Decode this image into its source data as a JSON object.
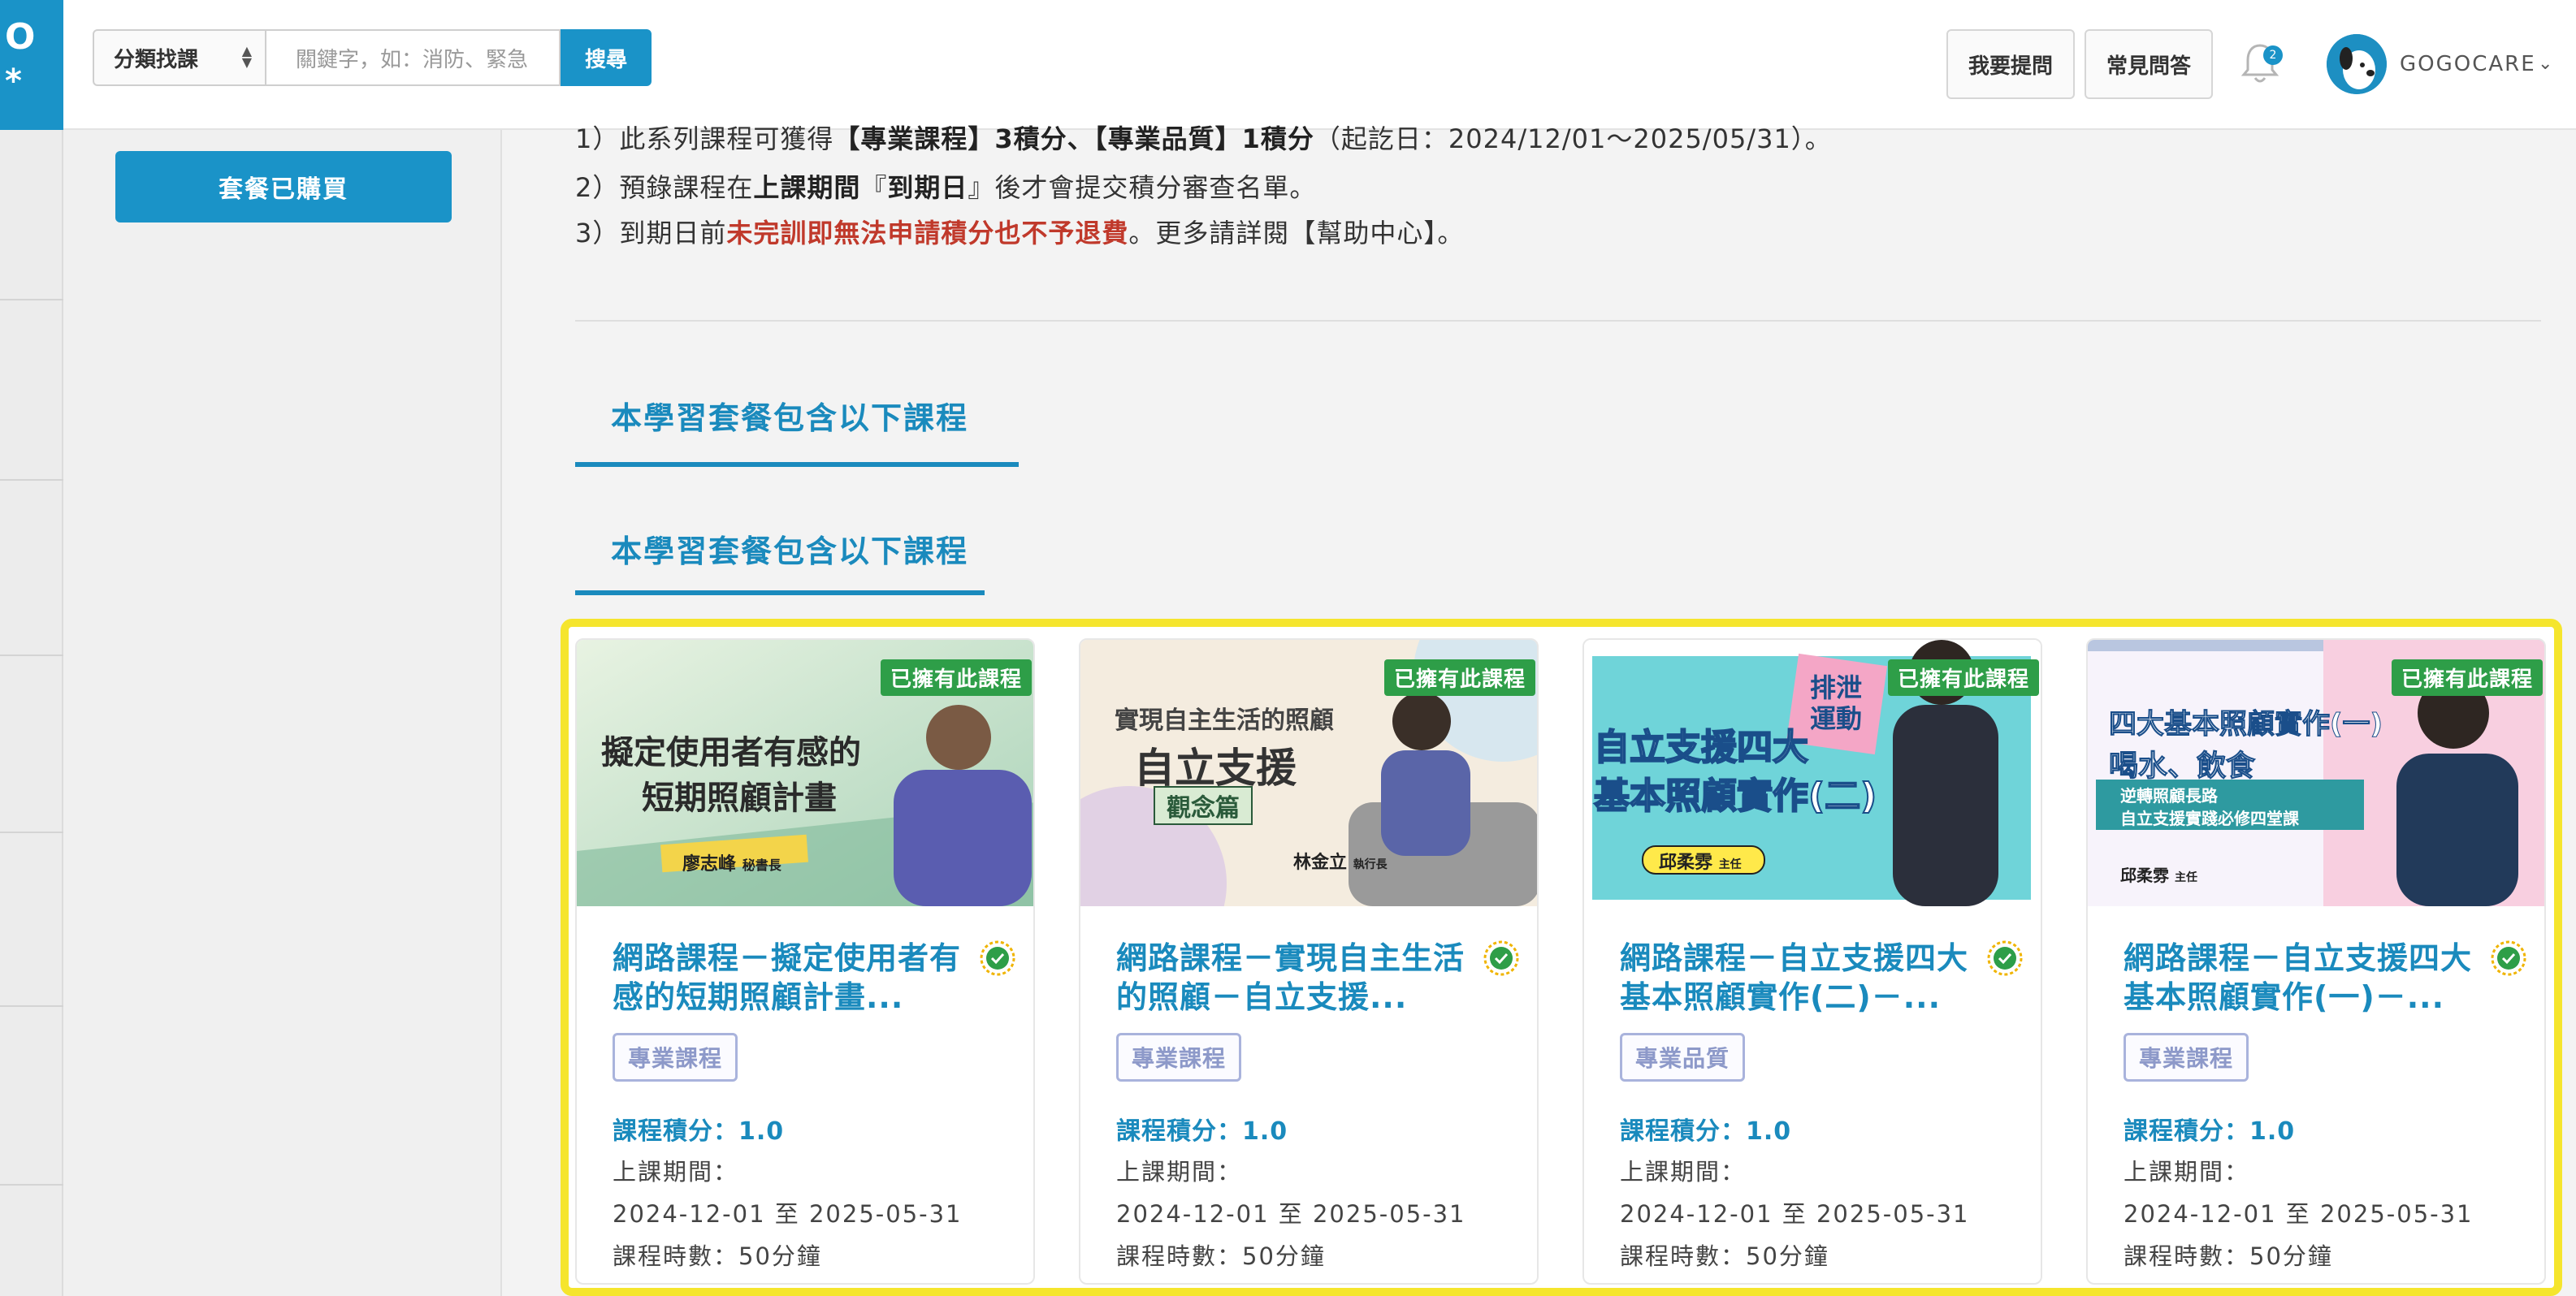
{
  "header": {
    "category_select": "分類找課",
    "search_placeholder": "關鍵字，如：消防、緊急",
    "search_button": "搜尋",
    "ask_button": "我要提問",
    "faq_button": "常見問答",
    "notification_count": "2",
    "user_name": "GOGOCARE"
  },
  "sidebar": {
    "purchased_button": "套餐已購買"
  },
  "notes": {
    "line1_prefix": "1）此系列課程可獲得",
    "line1_bold": "【專業課程】3積分、【專業品質】1積分",
    "line1_suffix": "（起訖日：2024/12/01～2025/05/31）。",
    "line2_prefix": "2）預錄課程在",
    "line2_bold1": "上課期間",
    "line2_mid": "『",
    "line2_bold2": "到期日",
    "line2_suffix": "』後才會提交積分審查名單。",
    "line3_prefix": "3）到期日前",
    "line3_red": "未完訓即無法申請積分也不予退費",
    "line3_suffix": "。更多請詳閱【幫助中心】。"
  },
  "sections": {
    "tab1": "本學習套餐包含以下課程",
    "tab2": "本學習套餐包含以下課程"
  },
  "cards": [
    {
      "badge": "已擁有此課程",
      "title": "網路課程－擬定使用者有感的短期照顧計畫...",
      "thumb_text1": "擬定使用者有感的",
      "thumb_text2": "短期照顧計畫",
      "thumb_person": "廖志峰",
      "thumb_role": "秘書長",
      "tag": "專業課程",
      "credit": "課程積分：1.0",
      "period_label": "上課期間：",
      "period": "2024-12-01 至 2025-05-31",
      "duration": "課程時數：50分鐘"
    },
    {
      "badge": "已擁有此課程",
      "title": "網路課程－實現自主生活的照顧－自立支援...",
      "thumb_text1": "實現自主生活的照顧",
      "thumb_text2": "自立支援",
      "thumb_text3": "觀念篇",
      "thumb_person": "林金立",
      "thumb_role": "執行長",
      "tag": "專業課程",
      "credit": "課程積分：1.0",
      "period_label": "上課期間：",
      "period": "2024-12-01 至 2025-05-31",
      "duration": "課程時數：50分鐘"
    },
    {
      "badge": "已擁有此課程",
      "title": "網路課程－自立支援四大基本照顧實作(二)－...",
      "thumb_text1": "自立支援四大",
      "thumb_text2": "基本照顧實作(二)",
      "thumb_text3": "排泄運動",
      "thumb_person": "邱柔雰",
      "thumb_role": "主任",
      "tag": "專業品質",
      "credit": "課程積分：1.0",
      "period_label": "上課期間：",
      "period": "2024-12-01 至 2025-05-31",
      "duration": "課程時數：50分鐘"
    },
    {
      "badge": "已擁有此課程",
      "title": "網路課程－自立支援四大基本照顧實作(一)－...",
      "thumb_text1": "四大基本照顧實作(一)",
      "thumb_text2": "喝水、飲食",
      "thumb_text3": "逆轉照顧長路",
      "thumb_text4": "自立支援實踐必修四堂課",
      "thumb_person": "邱柔雰",
      "thumb_role": "主任",
      "tag": "專業課程",
      "credit": "課程積分：1.0",
      "period_label": "上課期間：",
      "period": "2024-12-01 至 2025-05-31",
      "duration": "課程時數：50分鐘"
    }
  ],
  "colors": {
    "brand": "#1a93c8",
    "owned_badge": "#2e9e48",
    "highlight": "#f5e52d",
    "warning_red": "#c0392b"
  }
}
